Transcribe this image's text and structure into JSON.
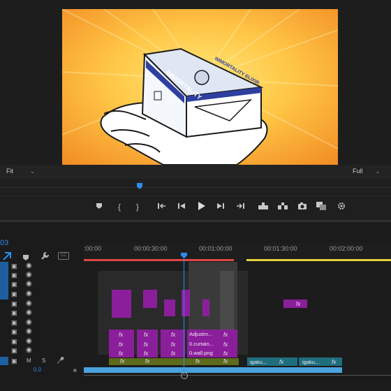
{
  "monitor": {
    "zoom_select": "Fit",
    "resolution_select": "Full",
    "preview": {
      "box_label": "IMMORTALITY",
      "box_side_label": "IMMORTALITY ELIXIR"
    }
  },
  "transport": {
    "icons": [
      "marker-icon",
      "mark-in-icon",
      "mark-out-icon",
      "go-to-in-icon",
      "step-back-icon",
      "play-icon",
      "step-forward-icon",
      "go-to-out-icon",
      "lift-icon",
      "extract-icon",
      "export-frame-icon",
      "comparison-view-icon",
      "settings-icon"
    ]
  },
  "timeline": {
    "sequence_label": "03",
    "timecodes": [
      ":00:00",
      "00:00:30:00",
      "00:01:00:00",
      "00:01:30:00",
      "00:02:00:00"
    ],
    "audio_controls": {
      "mute": "M",
      "solo": "S"
    },
    "clip_labels": {
      "fx": "fx",
      "adjustment": "Adjustm...",
      "curtain": "0.curtain...",
      "wall": "0.wall.png",
      "igaku_1": "igaku...",
      "igaku_2": "igaku..."
    },
    "footer_value": "0.0"
  },
  "colors": {
    "accent": "#2d8ceb",
    "clip_purple": "#8b1f9b",
    "clip_teal": "#1f6e7e",
    "audio_blue": "#4aa3dd",
    "preview_orange": "#f39b2c",
    "preview_yellow": "#ffe26a"
  }
}
